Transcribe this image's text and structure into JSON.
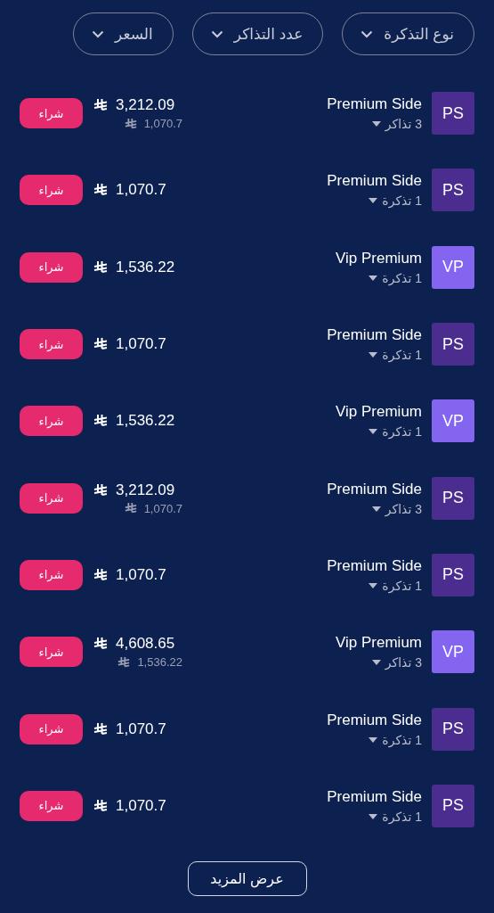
{
  "filters": [
    {
      "label": "نوع التذكرة"
    },
    {
      "label": "عدد التذاكر"
    },
    {
      "label": "السعر"
    }
  ],
  "tickets": [
    {
      "badge": "PS",
      "color": "#4b2d8f",
      "name": "Premium Side",
      "quantity": "3 تذاكر",
      "price": "3,212.09",
      "unit_price": "1,070.7",
      "buy": "شراء"
    },
    {
      "badge": "PS",
      "color": "#4b2d8f",
      "name": "Premium Side",
      "quantity": "1 تذكرة",
      "price": "1,070.7",
      "buy": "شراء"
    },
    {
      "badge": "VP",
      "color": "#8465f0",
      "name": "Vip Premium",
      "quantity": "1 تذكرة",
      "price": "1,536.22",
      "buy": "شراء"
    },
    {
      "badge": "PS",
      "color": "#4b2d8f",
      "name": "Premium Side",
      "quantity": "1 تذكرة",
      "price": "1,070.7",
      "buy": "شراء"
    },
    {
      "badge": "VP",
      "color": "#8465f0",
      "name": "Vip Premium",
      "quantity": "1 تذكرة",
      "price": "1,536.22",
      "buy": "شراء"
    },
    {
      "badge": "PS",
      "color": "#4b2d8f",
      "name": "Premium Side",
      "quantity": "3 تذاكر",
      "price": "3,212.09",
      "unit_price": "1,070.7",
      "buy": "شراء"
    },
    {
      "badge": "PS",
      "color": "#4b2d8f",
      "name": "Premium Side",
      "quantity": "1 تذكرة",
      "price": "1,070.7",
      "buy": "شراء"
    },
    {
      "badge": "VP",
      "color": "#8465f0",
      "name": "Vip Premium",
      "quantity": "3 تذاكر",
      "price": "4,608.65",
      "unit_price": "1,536.22",
      "buy": "شراء"
    },
    {
      "badge": "PS",
      "color": "#4b2d8f",
      "name": "Premium Side",
      "quantity": "1 تذكرة",
      "price": "1,070.7",
      "buy": "شراء"
    },
    {
      "badge": "PS",
      "color": "#4b2d8f",
      "name": "Premium Side",
      "quantity": "1 تذكرة",
      "price": "1,070.7",
      "buy": "شراء"
    }
  ],
  "more_button": "عرض المزيد"
}
